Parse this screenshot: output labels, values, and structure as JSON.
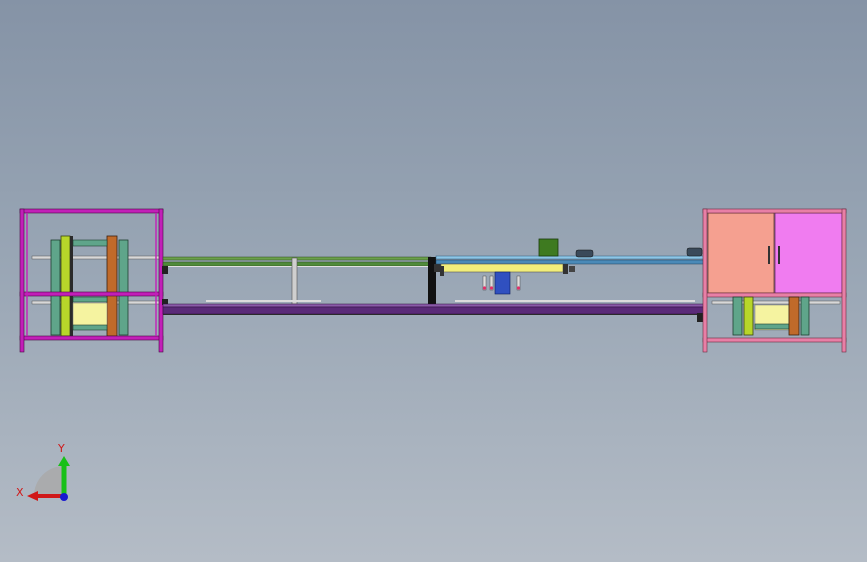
{
  "view": {
    "background_top": "#8593a6",
    "background_bottom": "#b4bcc6"
  },
  "colors": {
    "frame_magenta": "#c21fb8",
    "cabinet_salmon": "#f5a090",
    "cabinet_pink": "#f07cf0",
    "frame_pink": "#e87fa6",
    "rail_green": "#4f8a3a",
    "rail_blue": "#4a8ab8",
    "base_purple": "#5a2a78",
    "roller_teal": "#5fa58a",
    "plate_lime": "#b7d62a",
    "plate_orange": "#c06a2a",
    "panel_yellow": "#f5f3a0",
    "motor_green": "#3e7a20",
    "axis_red": "#d01818",
    "axis_green": "#18c018",
    "axis_blue": "#1818d0"
  },
  "triad": {
    "y_label": "Y",
    "x_label": "X",
    "icon": "coordinate-triad-icon"
  }
}
